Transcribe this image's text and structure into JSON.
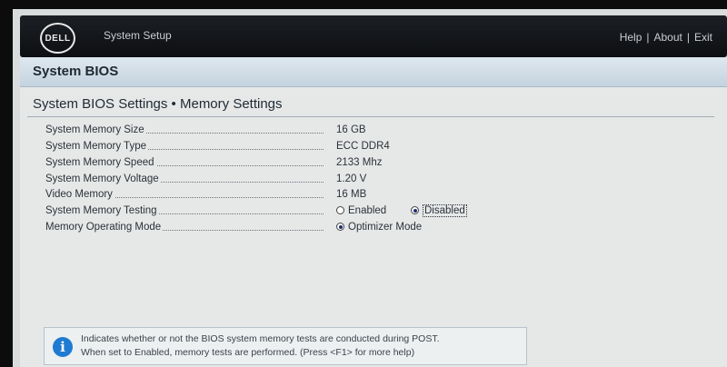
{
  "header": {
    "logo_text": "DELL",
    "title": "System Setup",
    "nav": [
      "Help",
      "About",
      "Exit"
    ]
  },
  "section": {
    "title": "System BIOS"
  },
  "page": {
    "title": "System BIOS Settings • Memory Settings"
  },
  "settings": [
    {
      "label": "System Memory Size",
      "value": "16 GB"
    },
    {
      "label": "System Memory Type",
      "value": "ECC DDR4"
    },
    {
      "label": "System Memory Speed",
      "value": "2133 Mhz"
    },
    {
      "label": "System Memory Voltage",
      "value": "1.20 V"
    },
    {
      "label": "Video Memory",
      "value": "16 MB"
    },
    {
      "label": "System Memory Testing",
      "options": [
        "Enabled",
        "Disabled"
      ],
      "selected": "Disabled"
    },
    {
      "label": "Memory Operating Mode",
      "options": [
        "Optimizer Mode"
      ],
      "selected": "Optimizer Mode"
    }
  ],
  "help": {
    "icon": "info-icon",
    "line1": "Indicates whether or not the BIOS system memory tests are conducted during POST.",
    "line2": "When set to Enabled, memory tests are performed. (Press <F1> for more help)"
  }
}
